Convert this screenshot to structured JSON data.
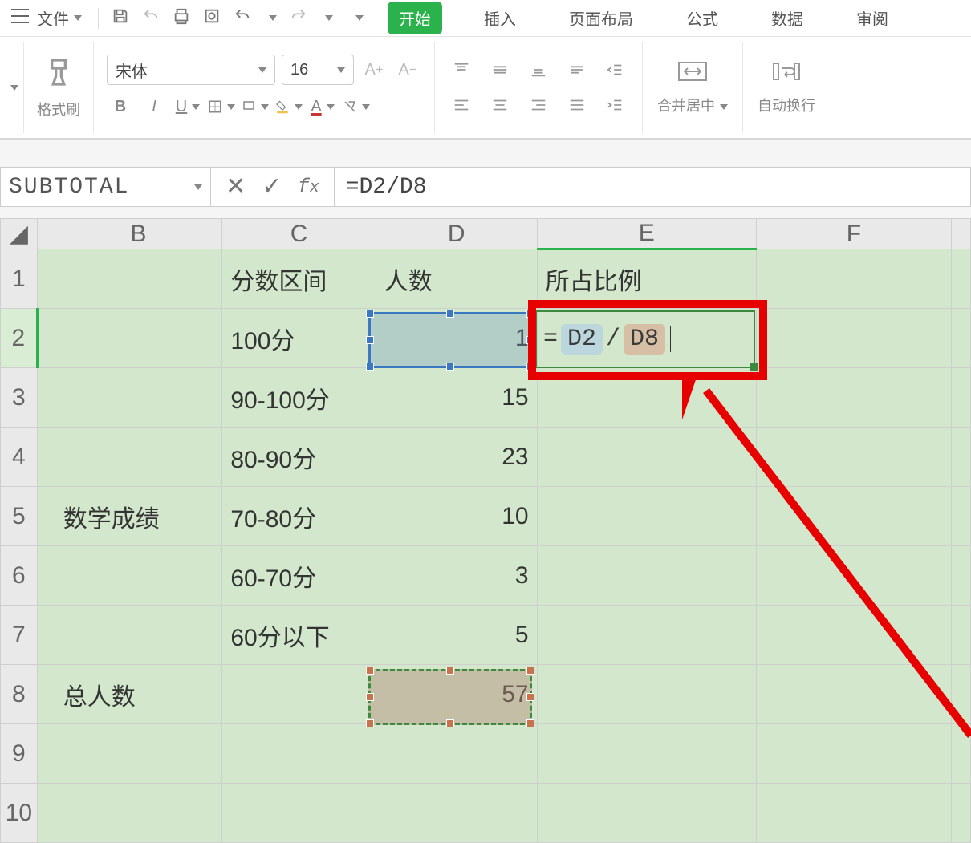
{
  "menu": {
    "file": "文件",
    "tabs": [
      "开始",
      "插入",
      "页面布局",
      "公式",
      "数据",
      "审阅"
    ]
  },
  "ribbon": {
    "format_painter": "格式刷",
    "font_name": "宋体",
    "font_size": "16",
    "merge_center": "合并居中",
    "wrap_text": "自动换行"
  },
  "formula_bar": {
    "name_box": "SUBTOTAL",
    "formula": "=D2/D8"
  },
  "columns": [
    "B",
    "C",
    "D",
    "E",
    "F"
  ],
  "rows": [
    "1",
    "2",
    "3",
    "4",
    "5",
    "6",
    "7",
    "8",
    "9",
    "10"
  ],
  "cells": {
    "C1": "分数区间",
    "D1": "人数",
    "E1": "所占比例",
    "B5": "数学成绩",
    "B8": "总人数",
    "C2": "100分",
    "C3": "90-100分",
    "C4": "80-90分",
    "C5": "70-80分",
    "C6": "60-70分",
    "C7": "60分以下",
    "D2": "1",
    "D3": "15",
    "D4": "23",
    "D5": "10",
    "D6": "3",
    "D7": "5",
    "D8": "57"
  },
  "e2_editor": {
    "eq": "=",
    "ref1": "D2",
    "slash": "/",
    "ref2": "D8"
  }
}
